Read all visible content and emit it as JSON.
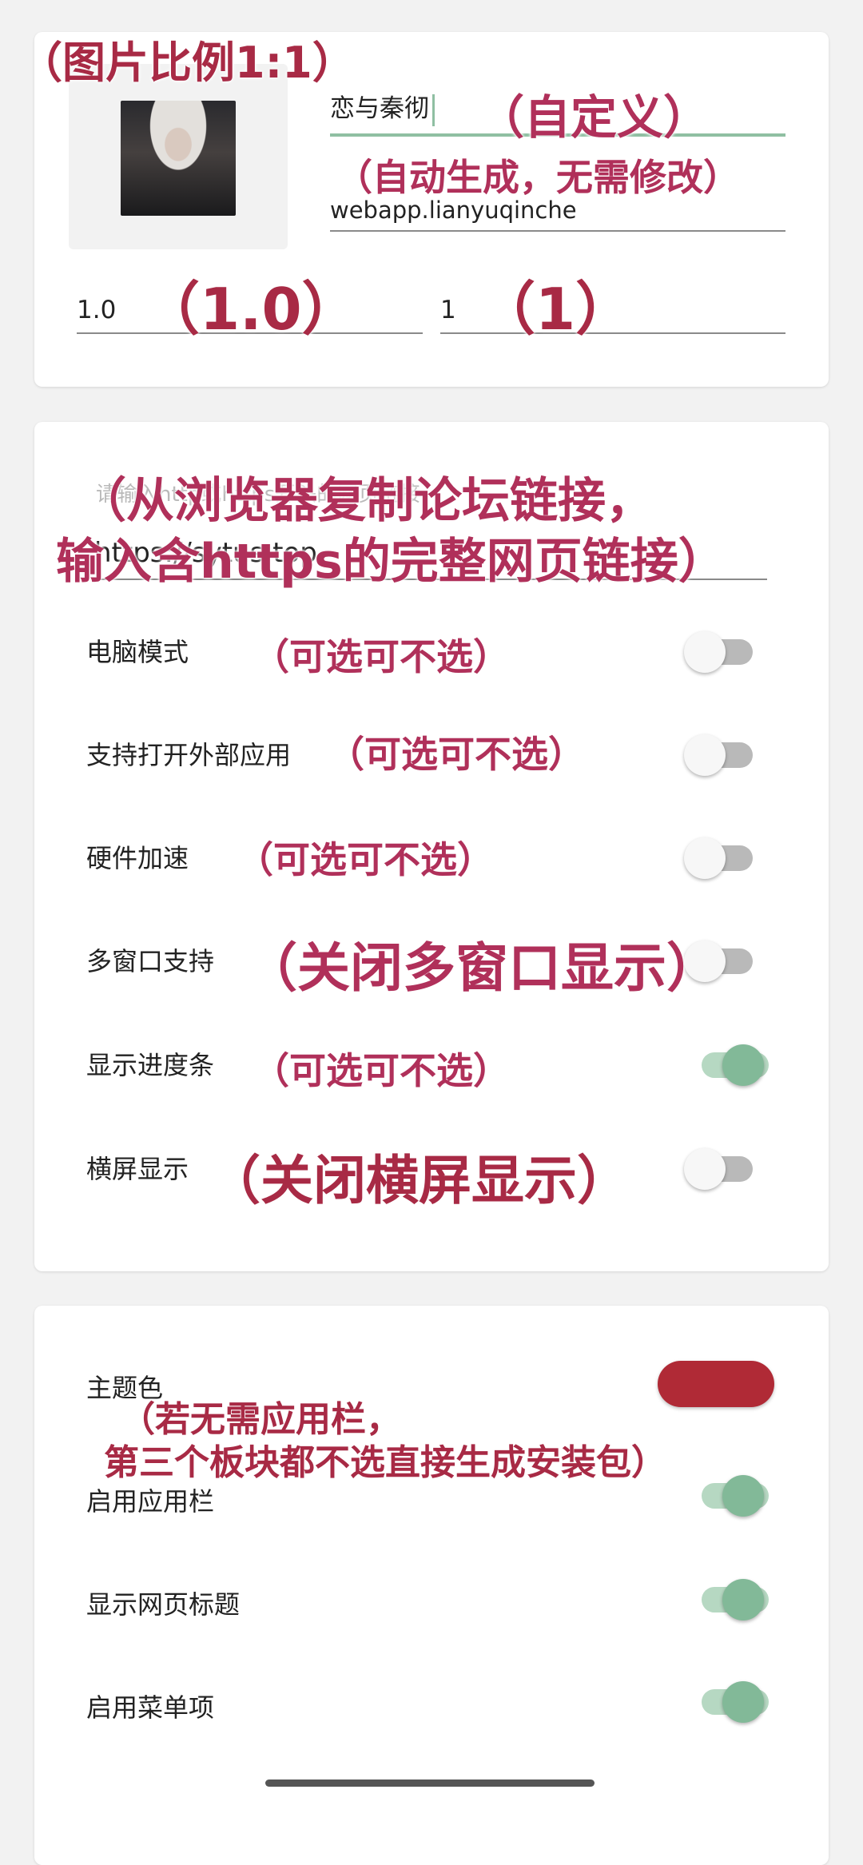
{
  "annotations": {
    "ratio": "（图片比例1:1）",
    "custom": "（自定义）",
    "auto": "（自动生成，无需修改）",
    "version_name": "（1.0）",
    "version_code": "（1）",
    "url_line1": "（从浏览器复制论坛链接，",
    "url_line2": "输入含https的完整网页链接）",
    "optional1": "（可选可不选）",
    "optional2": "（可选可不选）",
    "optional3": "（可选可不选）",
    "close_multi": "（关闭多窗口显示）",
    "optional4": "（可选可不选）",
    "close_landscape": "（关闭横屏显示）",
    "appbar_line1": "（若无需应用栏，",
    "appbar_line2": "第三个板块都不选直接生成安装包）"
  },
  "app_info": {
    "app_name": "恋与秦彻",
    "package_name": "webapp.lianyuqinche",
    "version_name": "1.0",
    "version_code": "1"
  },
  "url_section": {
    "placeholder": "请输入http或https开头的网页链接",
    "value": "https://sytus.top"
  },
  "options": [
    {
      "label": "电脑模式",
      "on": false
    },
    {
      "label": "支持打开外部应用",
      "on": false
    },
    {
      "label": "硬件加速",
      "on": false
    },
    {
      "label": "多窗口支持",
      "on": false
    },
    {
      "label": "显示进度条",
      "on": true
    },
    {
      "label": "横屏显示",
      "on": false
    }
  ],
  "theme": {
    "label": "主题色",
    "color": "#b02a36",
    "toggles": [
      {
        "label": "启用应用栏",
        "on": true
      },
      {
        "label": "显示网页标题",
        "on": true
      },
      {
        "label": "启用菜单项",
        "on": true
      }
    ]
  },
  "colors": {
    "accent": "#82b998",
    "annotation": "#b0305a"
  }
}
